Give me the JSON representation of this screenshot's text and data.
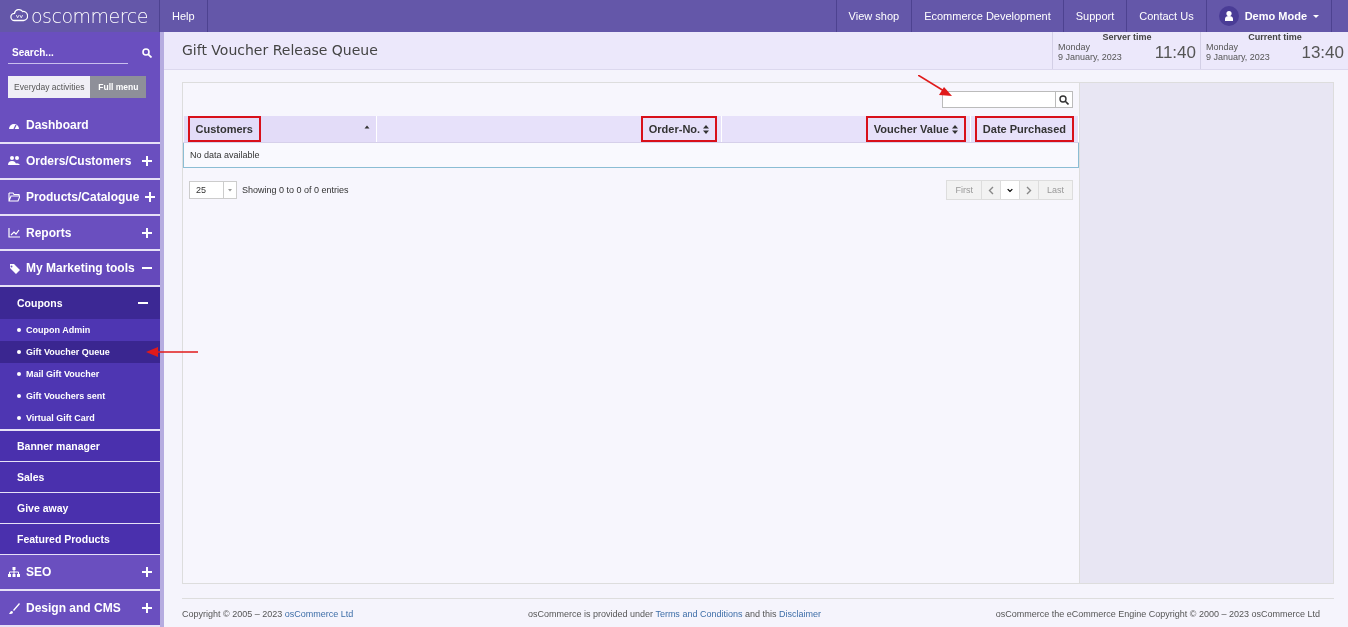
{
  "topbar": {
    "logo": "oscommerce",
    "left_links": [
      "Help"
    ],
    "right_links": [
      "View shop",
      "Ecommerce Development",
      "Support",
      "Contact Us"
    ],
    "user": "Demo Mode"
  },
  "sidebar": {
    "search": {
      "placeholder": "Search..."
    },
    "modes": [
      {
        "label": "Everyday activities",
        "selected": false
      },
      {
        "label": "Full menu",
        "selected": true
      }
    ],
    "items": [
      {
        "label": "Dashboard"
      },
      {
        "label": "Orders/Customers",
        "expanded": false
      },
      {
        "label": "Products/Catalogue",
        "expanded": false
      },
      {
        "label": "Reports",
        "expanded": false
      },
      {
        "label": "My Marketing tools",
        "expanded": true,
        "children": [
          {
            "label": "Coupons",
            "expanded": true,
            "children": [
              {
                "label": "Coupon Admin",
                "selected": false,
                "annotated": false
              },
              {
                "label": "Gift Voucher Queue",
                "selected": true,
                "annotated": true
              },
              {
                "label": "Mail Gift Voucher",
                "selected": false,
                "annotated": false
              },
              {
                "label": "Gift Vouchers sent",
                "selected": false,
                "annotated": false
              },
              {
                "label": "Virtual Gift Card",
                "selected": false,
                "annotated": false
              }
            ]
          },
          {
            "label": "Banner manager"
          },
          {
            "label": "Sales"
          },
          {
            "label": "Give away"
          },
          {
            "label": "Featured Products"
          }
        ]
      },
      {
        "label": "SEO",
        "expanded": false
      },
      {
        "label": "Design and CMS",
        "expanded": false
      }
    ]
  },
  "page_title": "Gift Voucher Release Queue",
  "clocks": [
    {
      "label": "Server time",
      "day": "Monday",
      "date": "9 January, 2023",
      "time": "11:40"
    },
    {
      "label": "Current time",
      "day": "Monday",
      "date": "9 January, 2023",
      "time": "13:40"
    }
  ],
  "table": {
    "search": {
      "annotated": true
    },
    "columns": [
      {
        "label": "Customers",
        "sortable": true,
        "sorted": true,
        "highlighted": true
      },
      {
        "label": "Order-No.",
        "sortable": true,
        "sorted": false,
        "highlighted": true
      },
      {
        "label": "Voucher Value",
        "sortable": true,
        "sorted": false,
        "highlighted": true
      },
      {
        "label": "Date Purchased",
        "sortable": false,
        "sorted": false,
        "highlighted": true
      }
    ],
    "empty_message": "No data available",
    "page_size": "25",
    "info": "Showing 0 to 0 of 0 entries",
    "pagination": [
      {
        "label": "First",
        "kind": "text",
        "disabled": true
      },
      {
        "kind": "prev",
        "disabled": true
      },
      {
        "kind": "current",
        "disabled": false
      },
      {
        "kind": "next",
        "disabled": true
      },
      {
        "label": "Last",
        "kind": "text",
        "disabled": true
      }
    ]
  },
  "footer": {
    "left": "Copyright © 2005 – 2023 ",
    "left_link": "osCommerce Ltd",
    "middle_before": "osCommerce is provided under ",
    "terms_link": "Terms and Conditions",
    "middle_between": " and this ",
    "disclaimer_link": "Disclaimer",
    "right": "osCommerce the eCommerce Engine Copyright © 2000 – 2023 osCommerce Ltd"
  }
}
